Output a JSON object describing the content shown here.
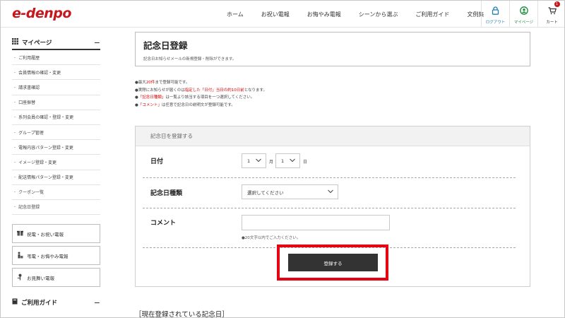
{
  "header": {
    "logo": "e-denpo",
    "nav": [
      "ホーム",
      "お祝い電報",
      "お悔やみ電報",
      "シーンから選ぶ",
      "ご利用ガイド",
      "文例集"
    ],
    "icons": {
      "logout": {
        "label": "ログアウト",
        "icon": "lock-icon",
        "color": "#1e7fb5"
      },
      "mypage": {
        "label": "マイページ",
        "icon": "person-icon",
        "color": "#1a8a3c"
      },
      "cart": {
        "label": "カート",
        "icon": "cart-icon",
        "count": "1"
      }
    },
    "brand_color": "#c8161d"
  },
  "sidebar": {
    "heading": "マイページ",
    "collapse": "−",
    "items": [
      "ご利用履歴",
      "会員情報の確認・変更",
      "請求書確認",
      "口座振替",
      "系列会員の確認・登録・変更",
      "グループ管理",
      "電報内容パターン登録・変更",
      "イメージ登録・変更",
      "配送情報パターン登録・変更",
      "クーポン一覧",
      "記念日登録"
    ],
    "buttons": [
      "祝電・お祝い電報",
      "弔電・お悔やみ電報",
      "お見舞い電報"
    ],
    "guide_heading": "ご利用ガイド",
    "guide_collapse": "−"
  },
  "main": {
    "title": "記念日登録",
    "subtitle": "記念日お知らせメールの新規登録・削除ができます。",
    "notes": {
      "n1": {
        "pre": "●最大",
        "red": "20件",
        "post": "まで登録可能です。"
      },
      "n2": {
        "pre": "●実際にお知らせが届くのは",
        "red": "指定した「日付」当日の約10日前",
        "post": "となります。"
      },
      "n3": {
        "pre": "●",
        "red": "「記念日種類」",
        "post": "は一覧より該当する項目を一つ選択してください。"
      },
      "n4": {
        "pre": "●",
        "red": "「コメント」",
        "post": "は任意で記念日の説明文が登録可能です。"
      }
    },
    "form": {
      "heading": "記念日を登録する",
      "date_label": "日付",
      "month_value": "1",
      "month_unit": "月",
      "day_value": "1",
      "day_unit": "日",
      "type_label": "記念日種類",
      "type_value": "選択してください",
      "comment_label": "コメント",
      "comment_value": "",
      "comment_help": "●20文字以内でご入力ください。",
      "submit": "登録する"
    },
    "registered_heading": "［現在登録されている記念日］",
    "highlight_color": "#e60012"
  }
}
